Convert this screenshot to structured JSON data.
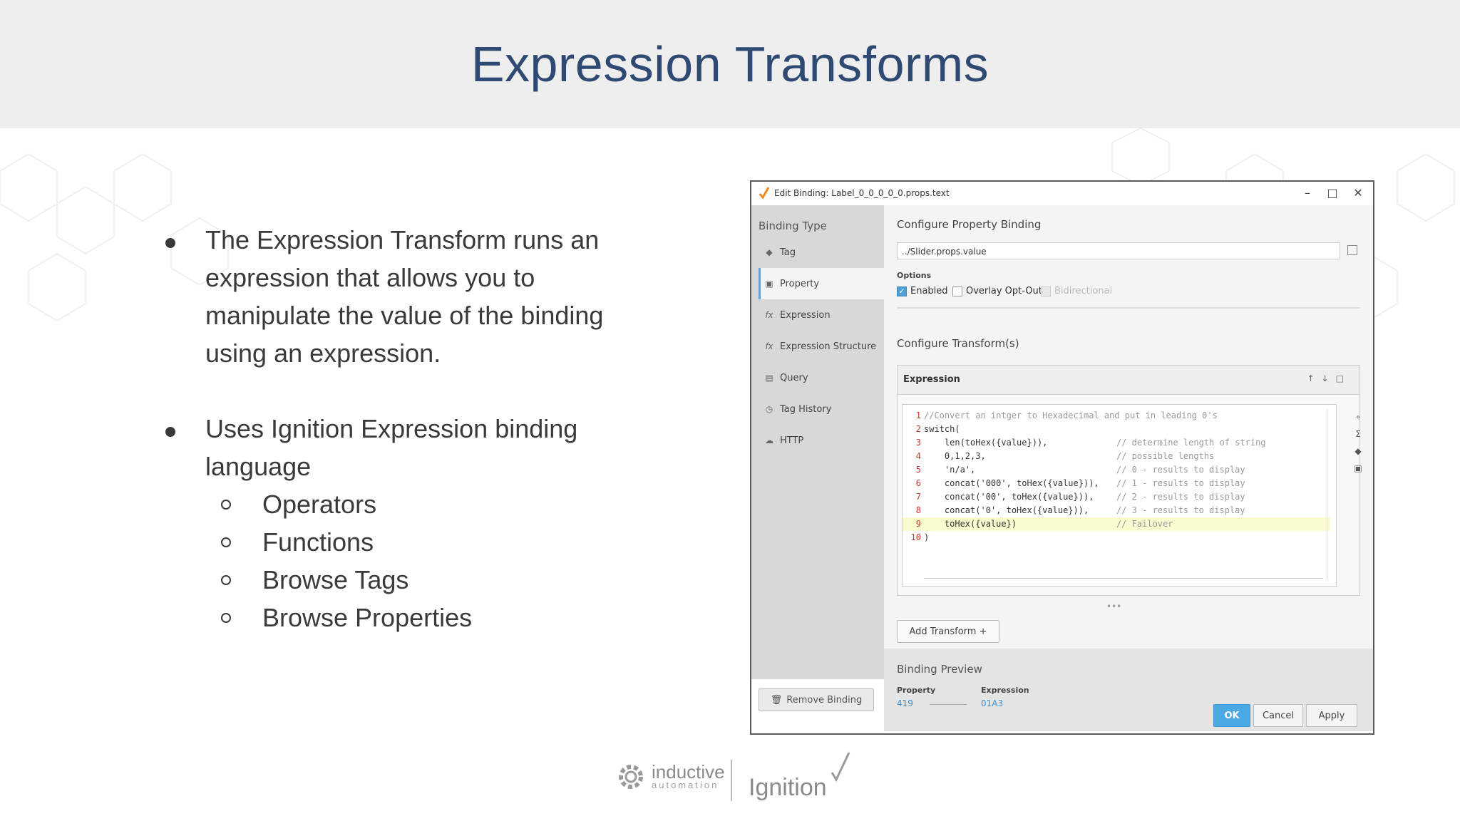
{
  "slide": {
    "title": "Expression Transforms",
    "bullets": [
      "The Expression Transform runs an expression that allows you to manipulate the value of the binding using an expression.",
      "Uses Ignition Expression binding language"
    ],
    "sub_bullets": [
      "Operators",
      "Functions",
      "Browse Tags",
      "Browse Properties"
    ]
  },
  "dialog": {
    "title": "Edit Binding: Label_0_0_0_0_0.props.text",
    "binding_type_header": "Binding Type",
    "binding_types": [
      {
        "label": "Tag",
        "icon": "tag-icon",
        "active": false
      },
      {
        "label": "Property",
        "icon": "property-icon",
        "active": true
      },
      {
        "label": "Expression",
        "icon": "function-icon",
        "active": false
      },
      {
        "label": "Expression Structure",
        "icon": "function-icon",
        "active": false
      },
      {
        "label": "Query",
        "icon": "database-icon",
        "active": false
      },
      {
        "label": "Tag History",
        "icon": "clock-icon",
        "active": false
      },
      {
        "label": "HTTP",
        "icon": "cloud-icon",
        "active": false
      }
    ],
    "remove_binding": "Remove Binding",
    "configure_property": "Configure Property Binding",
    "property_path": "../Slider.props.value",
    "options_label": "Options",
    "options": [
      {
        "label": "Enabled",
        "checked": true,
        "disabled": false
      },
      {
        "label": "Overlay Opt-Out",
        "checked": false,
        "disabled": false
      },
      {
        "label": "Bidirectional",
        "checked": false,
        "disabled": true
      }
    ],
    "configure_transforms": "Configure Transform(s)",
    "transform_label": "Expression",
    "code_lines": [
      {
        "n": "1",
        "code": "//Convert an intger to Hexadecimal and put in leading 0's",
        "comment": ""
      },
      {
        "n": "2",
        "code": "switch(",
        "comment": ""
      },
      {
        "n": "3",
        "code": "    len(toHex({value})),",
        "comment": "// determine length of string"
      },
      {
        "n": "4",
        "code": "    0,1,2,3,",
        "comment": "// possible lengths"
      },
      {
        "n": "5",
        "code": "    'n/a',",
        "comment": "// 0 - results to display"
      },
      {
        "n": "6",
        "code": "    concat('000', toHex({value})),",
        "comment": "// 1 - results to display"
      },
      {
        "n": "7",
        "code": "    concat('00', toHex({value})),",
        "comment": "// 2 - results to display"
      },
      {
        "n": "8",
        "code": "    concat('0', toHex({value})),",
        "comment": "// 3 - results to display"
      },
      {
        "n": "9",
        "code": "    toHex({value})",
        "comment": "// Failover"
      },
      {
        "n": "10",
        "code": ")",
        "comment": ""
      }
    ],
    "add_transform": "Add Transform +",
    "preview_header": "Binding Preview",
    "preview_property_label": "Property",
    "preview_property_value": "419",
    "preview_expression_label": "Expression",
    "preview_expression_value": "01A3",
    "ok": "OK",
    "cancel": "Cancel",
    "apply": "Apply"
  },
  "footer": {
    "logo_word1": "inductive",
    "logo_word2": "automation",
    "logo_ignition": "Ignition"
  },
  "colors": {
    "title": "#2f4a72",
    "accent": "#4aa8e4"
  }
}
